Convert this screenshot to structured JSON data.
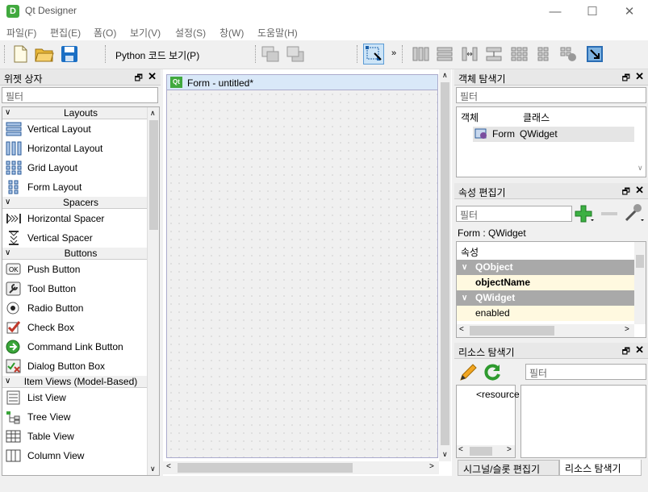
{
  "window": {
    "title": "Qt Designer",
    "icon_letter": "D",
    "minimize": "—",
    "maximize": "☐",
    "close": "✕"
  },
  "menu": [
    "파일(F)",
    "편집(E)",
    "폼(O)",
    "보기(V)",
    "설정(S)",
    "창(W)",
    "도움말(H)"
  ],
  "toolbar": {
    "python_code": "Python 코드 보기(P)",
    "more": "»"
  },
  "widget_box": {
    "title": "위젯 상자",
    "float": "🗗",
    "close": "✕",
    "filter_placeholder": "필터",
    "categories": [
      {
        "name": "Layouts",
        "items": [
          {
            "label": "Vertical Layout",
            "icon": "vertical-layout-icon"
          },
          {
            "label": "Horizontal Layout",
            "icon": "horizontal-layout-icon"
          },
          {
            "label": "Grid Layout",
            "icon": "grid-layout-icon"
          },
          {
            "label": "Form Layout",
            "icon": "form-layout-icon"
          }
        ]
      },
      {
        "name": "Spacers",
        "items": [
          {
            "label": "Horizontal Spacer",
            "icon": "horizontal-spacer-icon"
          },
          {
            "label": "Vertical Spacer",
            "icon": "vertical-spacer-icon"
          }
        ]
      },
      {
        "name": "Buttons",
        "items": [
          {
            "label": "Push Button",
            "icon": "push-button-icon"
          },
          {
            "label": "Tool Button",
            "icon": "tool-button-icon"
          },
          {
            "label": "Radio Button",
            "icon": "radio-button-icon"
          },
          {
            "label": "Check Box",
            "icon": "check-box-icon"
          },
          {
            "label": "Command Link Button",
            "icon": "command-link-icon"
          },
          {
            "label": "Dialog Button Box",
            "icon": "dialog-button-box-icon"
          }
        ]
      },
      {
        "name": "Item Views (Model-Based)",
        "items": [
          {
            "label": "List View",
            "icon": "list-view-icon"
          },
          {
            "label": "Tree View",
            "icon": "tree-view-icon"
          },
          {
            "label": "Table View",
            "icon": "table-view-icon"
          },
          {
            "label": "Column View",
            "icon": "column-view-icon"
          }
        ]
      }
    ]
  },
  "form": {
    "title": "Form - untitled*",
    "icon_text": "Qt"
  },
  "object_inspector": {
    "title": "객체 탐색기",
    "filter_placeholder": "필터",
    "col_object": "객체",
    "col_class": "클래스",
    "rows": [
      {
        "object": "Form",
        "class": "QWidget"
      }
    ]
  },
  "property_editor": {
    "title": "속성 편집기",
    "filter_placeholder": "필터",
    "context": "Form : QWidget",
    "header": "속성",
    "groups": [
      {
        "name": "QObject",
        "props": [
          "objectName"
        ]
      },
      {
        "name": "QWidget",
        "props": [
          "enabled"
        ]
      }
    ]
  },
  "resource_browser": {
    "title": "리소스 탐색기",
    "filter_placeholder": "필터",
    "root": "<resource"
  },
  "bottom_tabs": [
    "시그널/슬롯 편집기",
    "리소스 탐색기"
  ],
  "colors": {
    "accent": "#41a93e",
    "group_header": "#a9a9a9",
    "prop_row": "#fff9e0"
  }
}
